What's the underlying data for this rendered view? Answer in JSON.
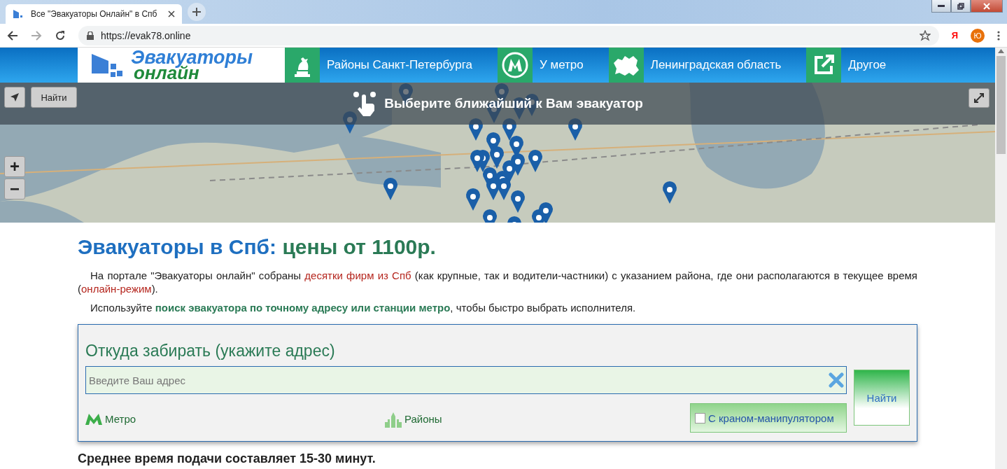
{
  "browser": {
    "tab_title": "Все \"Эвакуаторы Онлайн\" в Спб",
    "url": "https://evak78.online",
    "yandex": "Я",
    "profile": "Ю"
  },
  "nav": {
    "logo": {
      "line1": "Эвакуаторы",
      "line2": "онлайн"
    },
    "items": [
      {
        "label": "Районы Санкт-Петербурга",
        "kind": "monument"
      },
      {
        "label": "У метро",
        "kind": "metro"
      },
      {
        "label": "Ленинградская область",
        "kind": "region"
      },
      {
        "label": "Другое",
        "kind": "external"
      }
    ]
  },
  "map": {
    "find_button": "Найти",
    "banner": "Выберите ближайший к Вам эвакуатор",
    "zoom_in": "+",
    "zoom_out": "−"
  },
  "headline": {
    "lead": "Эвакуаторы в Спб:",
    "rest": "цены от 1100р."
  },
  "paragraphs": [
    [
      {
        "kind": "text",
        "text": "На портале \"Эвакуаторы онлайн\" собраны "
      },
      {
        "kind": "link",
        "text": "десятки фирм из Спб"
      },
      {
        "kind": "text",
        "text": " (как крупные, так и водители-частники) с указанием района, где они располагаются в текущее время ("
      },
      {
        "kind": "link",
        "text": "онлайн-режим"
      },
      {
        "kind": "text",
        "text": ")."
      }
    ],
    [
      {
        "kind": "text",
        "text": "Используйте "
      },
      {
        "kind": "strong",
        "text": "поиск эвакуатора по точному адресу или станции метро"
      },
      {
        "kind": "text",
        "text": ", чтобы быстро выбрать исполнителя."
      }
    ]
  ],
  "search_form": {
    "title": "Откуда забирать (укажите адрес)",
    "placeholder": "Введите Ваш адрес",
    "find_button": "Найти",
    "links": [
      {
        "label": "Метро",
        "kind": "metro"
      },
      {
        "label": "Районы",
        "kind": "districts"
      }
    ],
    "crane_option": {
      "label": "С краном-манипулятором",
      "checked": false
    }
  },
  "footer_note": "Среднее время подачи составляет 15-30 минут."
}
